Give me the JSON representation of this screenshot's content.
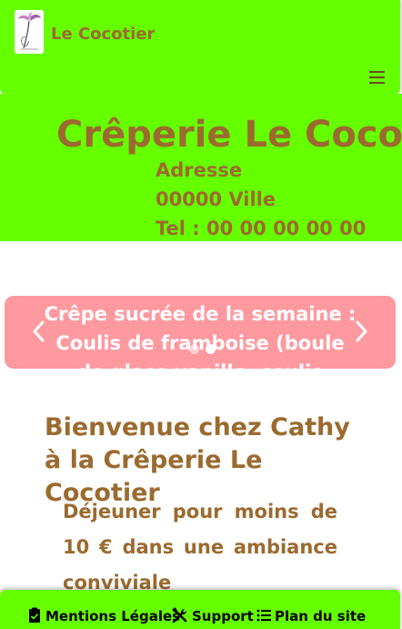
{
  "navbar": {
    "brand": "Le Cocotier",
    "logo_icon": "palm-tree-logo-icon",
    "menu_icon": "hamburger-menu-icon"
  },
  "hero": {
    "title": "Crêperie Le Cocotier",
    "address": "Adresse",
    "city": "00000 Ville",
    "phone": "Tel : 00 00 00 00 00"
  },
  "carousel": {
    "slide_text": "Crêpe sucrée de la semaine : Coulis de framboise (boule de glace vanille, coulis",
    "prev_icon": "chevron-left-icon",
    "next_icon": "chevron-right-icon",
    "slide_count": 2,
    "active_slide": 2
  },
  "main": {
    "welcome": "Bienvenue chez Cathy à la Crêperie Le Cocotier",
    "intro": "Déjeuner pour moins de 10 € dans une ambiance conviviale"
  },
  "footer": {
    "links": [
      {
        "label": "Mentions Légales",
        "icon": "clipboard-check-icon"
      },
      {
        "label": "Support",
        "icon": "tools-icon"
      },
      {
        "label": "Plan du site",
        "icon": "list-icon"
      }
    ]
  },
  "colors": {
    "accent_green": "#66ff00",
    "brown_text": "#9b6a2f",
    "carousel_pink": "#ff99a0"
  }
}
